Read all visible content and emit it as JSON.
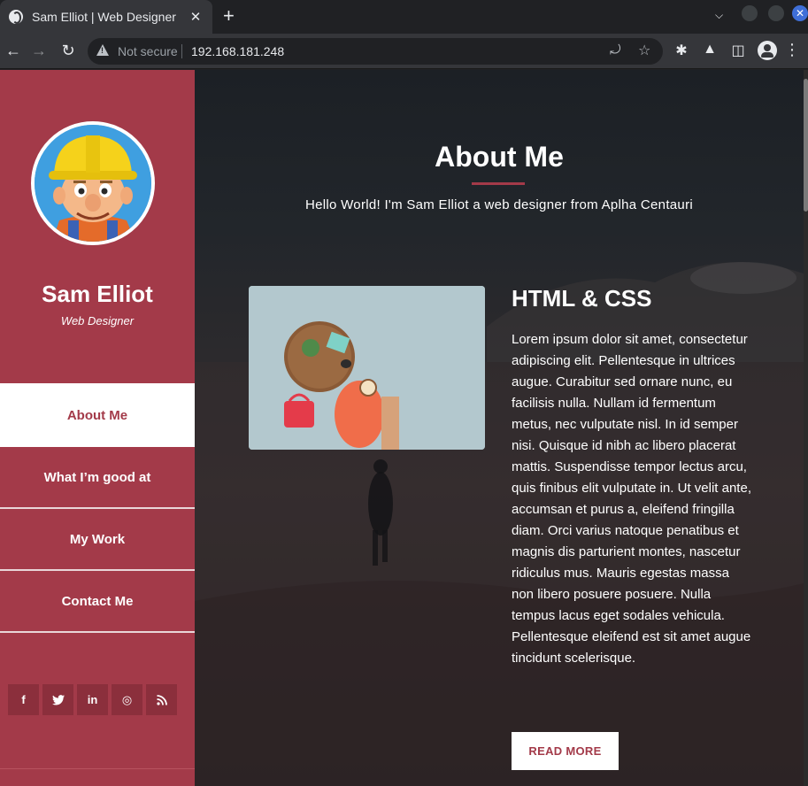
{
  "browser": {
    "tab_title": "Sam Elliot | Web Designer",
    "tab_close": "✕",
    "new_tab": "+",
    "security_label": "Not secure",
    "url": "192.168.181.248"
  },
  "sidebar": {
    "name": "Sam Elliot",
    "role": "Web Designer",
    "nav": [
      {
        "label": "About Me",
        "active": true
      },
      {
        "label": "What I’m good at",
        "active": false
      },
      {
        "label": "My Work",
        "active": false
      },
      {
        "label": "Contact Me",
        "active": false
      }
    ],
    "socials": [
      {
        "icon": "facebook-icon",
        "glyph": "f"
      },
      {
        "icon": "twitter-icon",
        "glyph": "🐦"
      },
      {
        "icon": "linkedin-icon",
        "glyph": "in"
      },
      {
        "icon": "dribbble-icon",
        "glyph": "◎"
      },
      {
        "icon": "rss-icon",
        "glyph": "☰"
      }
    ]
  },
  "main": {
    "title": "About Me",
    "subtitle": "Hello World! I'm Sam Elliot a web designer from Aplha Centauri",
    "skill_title": "HTML & CSS",
    "skill_text": "Lorem ipsum dolor sit amet, consectetur adipiscing elit. Pellentesque in ultrices augue. Curabitur sed ornare nunc, eu facilisis nulla. Nullam id fermentum metus, nec vulputate nisl. In id semper nisi. Quisque id nibh ac libero placerat mattis. Suspendisse tempor lectus arcu, quis finibus elit vulputate in. Ut velit ante, accumsan et purus a, eleifend fringilla diam. Orci varius natoque penatibus et magnis dis parturient montes, nascetur ridiculus mus. Mauris egestas massa non libero posuere posuere. Nulla tempus lacus eget sodales vehicula. Pellentesque eleifend est sit amet augue tincidunt scelerisque.",
    "read_more": "READ MORE"
  },
  "colors": {
    "accent": "#a33a49",
    "sidebar_social_bg": "#8b2f3c",
    "chrome_dark": "#202124",
    "chrome_toolbar": "#35363a"
  }
}
